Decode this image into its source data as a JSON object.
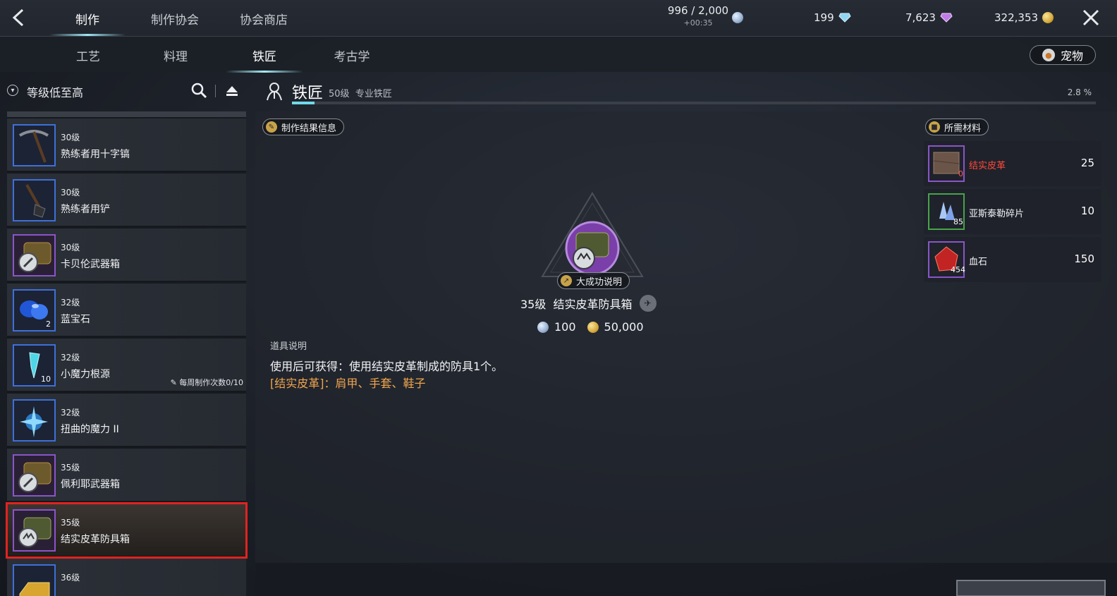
{
  "top_tabs": [
    {
      "label": "制作",
      "active": true
    },
    {
      "label": "制作协会",
      "active": false
    },
    {
      "label": "协会商店",
      "active": false
    }
  ],
  "energy": {
    "value": "996 / 2,000",
    "timer": "+00:35"
  },
  "currencies": {
    "blue_diamond": "199",
    "purple_diamond": "7,623",
    "gold": "322,353"
  },
  "sub_tabs": [
    {
      "label": "工艺",
      "active": false
    },
    {
      "label": "料理",
      "active": false
    },
    {
      "label": "铁匠",
      "active": true
    },
    {
      "label": "考古学",
      "active": false
    }
  ],
  "pet_button": "宠物",
  "sort_label": "等级低至高",
  "recipes": [
    {
      "level": "30级",
      "name": "熟练者用十字镐",
      "frame": "blue",
      "icon": "pickaxe-icon"
    },
    {
      "level": "30级",
      "name": "熟练者用铲",
      "frame": "blue",
      "icon": "shovel-icon"
    },
    {
      "level": "30级",
      "name": "卡贝伦武器箱",
      "frame": "purple",
      "icon": "weapon-chest-icon"
    },
    {
      "level": "32级",
      "name": "蓝宝石",
      "frame": "blue",
      "icon": "sapphire-icon",
      "count": "2"
    },
    {
      "level": "32级",
      "name": "小魔力根源",
      "frame": "blue",
      "icon": "mana-crystal-icon",
      "count": "10",
      "weekly": "每周制作次数0/10"
    },
    {
      "level": "32级",
      "name": "扭曲的魔力 II",
      "frame": "blue",
      "icon": "twisted-mana-icon"
    },
    {
      "level": "35级",
      "name": "佩利耶武器箱",
      "frame": "purple",
      "icon": "weapon-chest-icon"
    },
    {
      "level": "35级",
      "name": "结实皮革防具箱",
      "frame": "purple",
      "icon": "armor-chest-icon",
      "selected": true
    },
    {
      "level": "36级",
      "name": "",
      "frame": "blue",
      "icon": "gold-ingot-icon"
    }
  ],
  "profession": {
    "name": "铁匠",
    "level": "50级",
    "rank": "专业铁匠",
    "progress_text": "2.8 %",
    "progress": 0.028
  },
  "result_info_label": "制作结果信息",
  "great_success_label": "大成功说明",
  "item": {
    "level": "35级",
    "name": "结实皮革防具箱",
    "cost_energy": "100",
    "cost_gold": "50,000"
  },
  "description": {
    "label": "道具说明",
    "main": "使用后可获得：使用结实皮革制成的防具1个。",
    "sub": "[结实皮革]：肩甲、手套、鞋子"
  },
  "materials_label": "所需材料",
  "materials": [
    {
      "name": "结实皮革",
      "qty": "25",
      "owned": "0",
      "insufficient": true,
      "frame": "purple"
    },
    {
      "name": "亚斯泰勒碎片",
      "qty": "10",
      "owned": "85",
      "insufficient": false,
      "frame": "green"
    },
    {
      "name": "血石",
      "qty": "150",
      "owned": "454",
      "insufficient": false,
      "frame": "purple"
    }
  ],
  "colors": {
    "accent": "#6fd9ea",
    "selected_outline": "#e0231f",
    "warning_text": "#ff4a3a",
    "desc_highlight": "#f0a54e"
  }
}
